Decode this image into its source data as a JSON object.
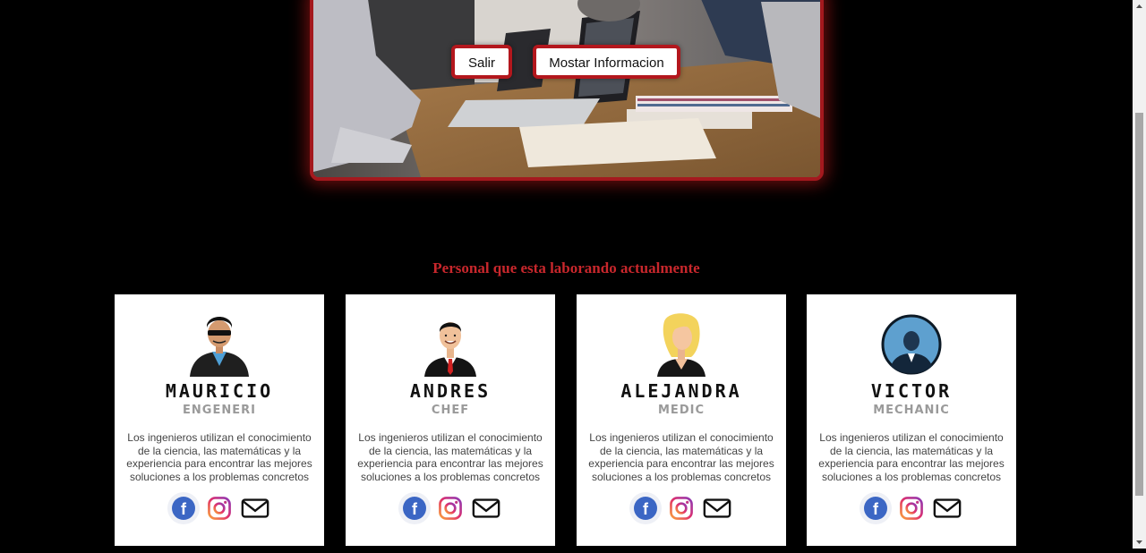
{
  "hero": {
    "buttons": {
      "exit_label": "Salir",
      "info_label": "Mostar Informacion"
    }
  },
  "section": {
    "title": "Personal que esta laborando actualmente"
  },
  "staff": [
    {
      "name": "MAURICIO",
      "role": "ENGENERI",
      "description": "Los ingenieros utilizan el conocimiento de la ciencia, las matemáticas y la experiencia para encontrar las mejores soluciones a los problemas concretos",
      "avatar_icon": "sunglasses-man-icon"
    },
    {
      "name": "ANDRES",
      "role": "CHEF",
      "description": "Los ingenieros utilizan el conocimiento de la ciencia, las matemáticas y la experiencia para encontrar las mejores soluciones a los problemas concretos",
      "avatar_icon": "businessman-icon"
    },
    {
      "name": "ALEJANDRA",
      "role": "MEDIC",
      "description": "Los ingenieros utilizan el conocimiento de la ciencia, las matemáticas y la experiencia para encontrar las mejores soluciones a los problemas concretos",
      "avatar_icon": "blonde-woman-icon"
    },
    {
      "name": "VICTOR",
      "role": "MECHANIC",
      "description": "Los ingenieros utilizan el conocimiento de la ciencia, las matemáticas y la experiencia para encontrar las mejores soluciones a los problemas concretos",
      "avatar_icon": "man-in-circle-icon"
    }
  ],
  "social_icons": [
    "facebook-icon",
    "instagram-icon",
    "mail-icon"
  ],
  "colors": {
    "accent": "#c8272c",
    "frame": "#a4191e",
    "background": "#000000",
    "card": "#ffffff"
  }
}
